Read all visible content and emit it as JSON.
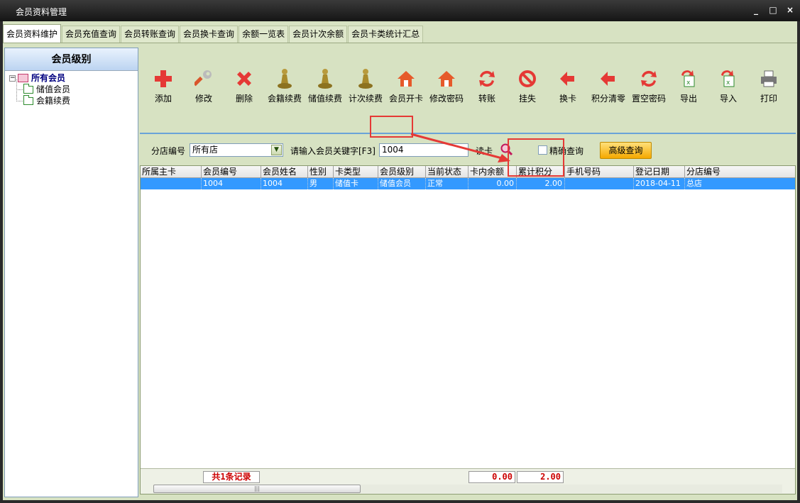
{
  "window": {
    "title": "会员资料管理",
    "min": "_",
    "max": "□",
    "close": "×"
  },
  "tabs": [
    "会员资料维护",
    "会员充值查询",
    "会员转账查询",
    "会员换卡查询",
    "余额一览表",
    "会员计次余额",
    "会员卡类统计汇总"
  ],
  "left_panel": {
    "header": "会员级别",
    "root": "所有会员",
    "children": [
      "储值会员",
      "会籍续费"
    ]
  },
  "toolbar": [
    {
      "label": "添加",
      "icon": "plus-icon",
      "color": "#e53935"
    },
    {
      "label": "修改",
      "icon": "wrench-icon",
      "color": "#d9552b"
    },
    {
      "label": "删除",
      "icon": "delete-x-icon",
      "color": "#e53935"
    },
    {
      "label": "会籍续费",
      "icon": "pawn-icon",
      "color": "#b89a3c"
    },
    {
      "label": "储值续费",
      "icon": "pawn-icon",
      "color": "#b89a3c"
    },
    {
      "label": "计次续费",
      "icon": "pawn-icon",
      "color": "#b89a3c"
    },
    {
      "label": "会员开卡",
      "icon": "house-icon",
      "color": "#e65a2a"
    },
    {
      "label": "修改密码",
      "icon": "house-icon",
      "color": "#e65a2a"
    },
    {
      "label": "转账",
      "icon": "transfer-icon",
      "color": "#e53935"
    },
    {
      "label": "挂失",
      "icon": "no-entry-icon",
      "color": "#e53935"
    },
    {
      "label": "换卡",
      "icon": "swap-arrow-icon",
      "color": "#e53935"
    },
    {
      "label": "积分清零",
      "icon": "swap-arrow-icon",
      "color": "#e53935"
    },
    {
      "label": "置空密码",
      "icon": "transfer-icon",
      "color": "#e53935"
    },
    {
      "label": "导出",
      "icon": "export-icon",
      "color": "#e53935"
    },
    {
      "label": "导入",
      "icon": "import-icon",
      "color": "#e53935"
    },
    {
      "label": "打印",
      "icon": "printer-icon",
      "color": "#555555"
    }
  ],
  "search": {
    "store_label": "分店编号",
    "store_value": "所有店",
    "keyword_label": "请输入会员关键字[F3]",
    "keyword_value": "1004",
    "read_card": "读卡",
    "exact_label": "精确查询",
    "advanced": "高级查询"
  },
  "grid": {
    "columns": [
      "所属主卡",
      "会员编号",
      "会员姓名",
      "性别",
      "卡类型",
      "会员级别",
      "当前状态",
      "卡内余额",
      "累计积分",
      "手机号码",
      "登记日期",
      "分店编号"
    ],
    "rows": [
      [
        "",
        "1004",
        "1004",
        "男",
        "储值卡",
        "储值会员",
        "正常",
        "0.00",
        "2.00",
        "",
        "2018-04-11",
        "总店"
      ]
    ],
    "footer": {
      "record_count": "共1条记录",
      "balance_total": "0.00",
      "points_total": "2.00"
    }
  },
  "colors": {
    "selection": "#3399ff",
    "highlight": "#e53935",
    "accent_button": "#f5a800"
  }
}
